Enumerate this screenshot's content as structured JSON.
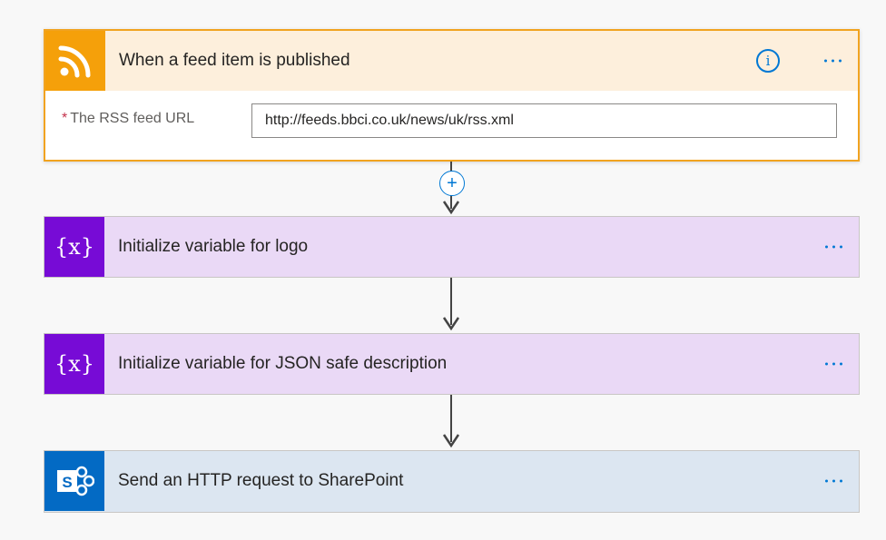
{
  "trigger": {
    "title": "When a feed item is published",
    "icon": "rss-icon",
    "info_icon": "info-icon",
    "more_icon": "more-options-icon",
    "param": {
      "required_marker": "*",
      "label": "The RSS feed URL",
      "value": "http://feeds.bbci.co.uk/news/uk/rss.xml"
    },
    "colors": {
      "border": "#f1a320",
      "header_bg": "#fdefdc",
      "icon_bg": "#f5a00a"
    }
  },
  "add_step": {
    "icon": "add-step-plus-icon",
    "symbol": "+"
  },
  "actions": [
    {
      "title": "Initialize variable for logo",
      "icon": "variable-icon",
      "icon_text": "{x}",
      "colors": {
        "bg": "#ead9f6",
        "icon_bg": "#770bd6"
      }
    },
    {
      "title": "Initialize variable for JSON safe description",
      "icon": "variable-icon",
      "icon_text": "{x}",
      "colors": {
        "bg": "#ead9f6",
        "icon_bg": "#770bd6"
      }
    },
    {
      "title": "Send an HTTP request to SharePoint",
      "icon": "sharepoint-icon",
      "icon_text": "S",
      "colors": {
        "bg": "#dce6f1",
        "icon_bg": "#036ac4"
      }
    }
  ],
  "accent_color": "#0078d4"
}
